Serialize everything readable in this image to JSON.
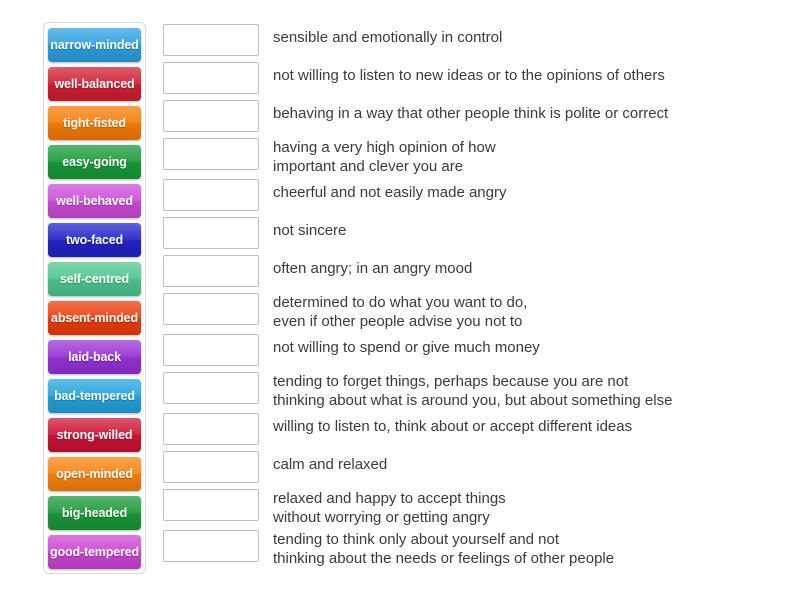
{
  "activity": {
    "type": "match-up",
    "tray_label": "word tiles",
    "tiles": [
      {
        "label": "narrow-minded",
        "color": "#2e9fe0"
      },
      {
        "label": "well-balanced",
        "color": "#d01f32"
      },
      {
        "label": "tight-fisted",
        "color": "#f57c08"
      },
      {
        "label": "easy-going",
        "color": "#189a38"
      },
      {
        "label": "well-behaved",
        "color": "#cc4bd8"
      },
      {
        "label": "two-faced",
        "color": "#2323c8"
      },
      {
        "label": "self-centred",
        "color": "#4cc68f"
      },
      {
        "label": "absent-minded",
        "color": "#ec3d0b"
      },
      {
        "label": "laid-back",
        "color": "#9632d6"
      },
      {
        "label": "bad-tempered",
        "color": "#23a3dc"
      },
      {
        "label": "strong-willed",
        "color": "#cc1335"
      },
      {
        "label": "open-minded",
        "color": "#f7820d"
      },
      {
        "label": "big-headed",
        "color": "#1a9838"
      },
      {
        "label": "good-tempered",
        "color": "#cc44d4"
      }
    ],
    "rows": [
      {
        "answer": "",
        "definition": "sensible and emotionally in control"
      },
      {
        "answer": "",
        "definition": "not willing to listen to new ideas or to the opinions of others"
      },
      {
        "answer": "",
        "definition": "behaving in a way that other people think is polite or correct"
      },
      {
        "answer": "",
        "definition": "having a very high opinion of how\nimportant and clever you are"
      },
      {
        "answer": "",
        "definition": "cheerful and not easily made angry"
      },
      {
        "answer": "",
        "definition": "not sincere"
      },
      {
        "answer": "",
        "definition": "often angry; in an angry mood"
      },
      {
        "answer": "",
        "definition": "determined to do what you want to do,\neven if other people advise you not to"
      },
      {
        "answer": "",
        "definition": "not willing to spend or give much money"
      },
      {
        "answer": "",
        "definition": "tending to forget things, perhaps because you are not\nthinking about what is around you, but about something else"
      },
      {
        "answer": "",
        "definition": "willing to listen to, think about or accept different ideas"
      },
      {
        "answer": "",
        "definition": "calm and relaxed"
      },
      {
        "answer": "",
        "definition": "relaxed and happy to accept things\nwithout worrying or getting angry"
      },
      {
        "answer": "",
        "definition": "tending to think only about yourself and not\nthinking about the needs or feelings of other people"
      }
    ],
    "colors": {
      "page_background": "#ffffff",
      "tray_border": "#d9d9d9",
      "dropzone_border": "#bfbfbf",
      "definition_text": "#3a3a3a",
      "tile_text": "#ffffff"
    }
  }
}
